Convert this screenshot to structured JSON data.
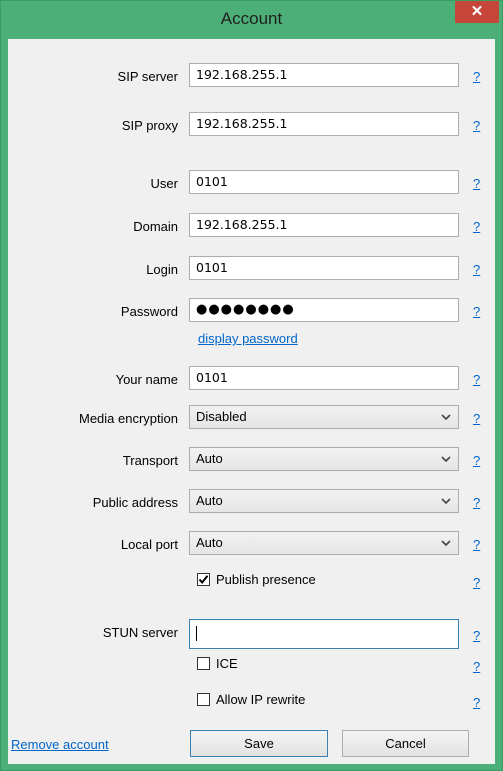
{
  "window": {
    "title": "Account",
    "close_glyph": "✕"
  },
  "fields": {
    "sip_server": {
      "label": "SIP server",
      "value": "192.168.255.1"
    },
    "sip_proxy": {
      "label": "SIP proxy",
      "value": "192.168.255.1"
    },
    "user": {
      "label": "User",
      "value": "0101"
    },
    "domain": {
      "label": "Domain",
      "value": "192.168.255.1"
    },
    "login": {
      "label": "Login",
      "value": "0101"
    },
    "password": {
      "label": "Password",
      "masked_value": "●●●●●●●●"
    },
    "display_password_link": "display password",
    "your_name": {
      "label": "Your name",
      "value": "0101"
    },
    "media_encryption": {
      "label": "Media encryption",
      "value": "Disabled"
    },
    "transport": {
      "label": "Transport",
      "value": "Auto"
    },
    "public_address": {
      "label": "Public address",
      "value": "Auto"
    },
    "local_port": {
      "label": "Local port",
      "value": "Auto"
    },
    "publish_presence": {
      "label": "Publish presence",
      "checked": true
    },
    "stun_server": {
      "label": "STUN server",
      "value": ""
    },
    "ice": {
      "label": "ICE",
      "checked": false
    },
    "allow_ip_rewrite": {
      "label": "Allow IP rewrite",
      "checked": false
    }
  },
  "help_glyph": "?",
  "footer": {
    "remove_account": "Remove account",
    "save": "Save",
    "cancel": "Cancel"
  },
  "colors": {
    "frame": "#4caf78",
    "close": "#c7463a",
    "link": "#0066cc",
    "client_bg": "#f0f0f0"
  }
}
